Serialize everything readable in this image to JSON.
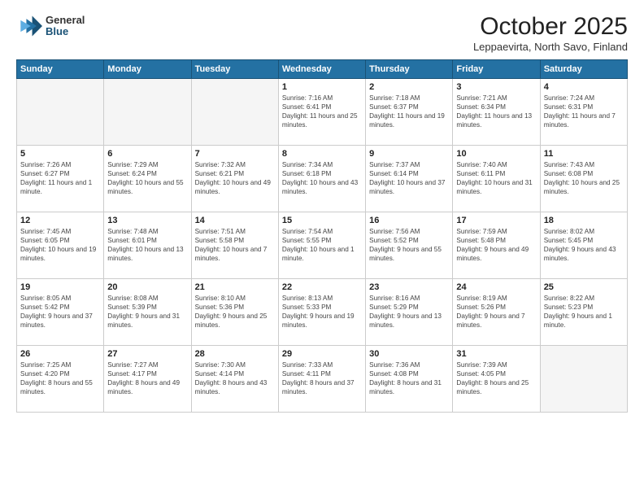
{
  "logo": {
    "general": "General",
    "blue": "Blue"
  },
  "title": "October 2025",
  "location": "Leppaevirta, North Savo, Finland",
  "days_header": [
    "Sunday",
    "Monday",
    "Tuesday",
    "Wednesday",
    "Thursday",
    "Friday",
    "Saturday"
  ],
  "weeks": [
    [
      {
        "num": "",
        "info": ""
      },
      {
        "num": "",
        "info": ""
      },
      {
        "num": "",
        "info": ""
      },
      {
        "num": "1",
        "info": "Sunrise: 7:16 AM\nSunset: 6:41 PM\nDaylight: 11 hours and 25 minutes."
      },
      {
        "num": "2",
        "info": "Sunrise: 7:18 AM\nSunset: 6:37 PM\nDaylight: 11 hours and 19 minutes."
      },
      {
        "num": "3",
        "info": "Sunrise: 7:21 AM\nSunset: 6:34 PM\nDaylight: 11 hours and 13 minutes."
      },
      {
        "num": "4",
        "info": "Sunrise: 7:24 AM\nSunset: 6:31 PM\nDaylight: 11 hours and 7 minutes."
      }
    ],
    [
      {
        "num": "5",
        "info": "Sunrise: 7:26 AM\nSunset: 6:27 PM\nDaylight: 11 hours and 1 minute."
      },
      {
        "num": "6",
        "info": "Sunrise: 7:29 AM\nSunset: 6:24 PM\nDaylight: 10 hours and 55 minutes."
      },
      {
        "num": "7",
        "info": "Sunrise: 7:32 AM\nSunset: 6:21 PM\nDaylight: 10 hours and 49 minutes."
      },
      {
        "num": "8",
        "info": "Sunrise: 7:34 AM\nSunset: 6:18 PM\nDaylight: 10 hours and 43 minutes."
      },
      {
        "num": "9",
        "info": "Sunrise: 7:37 AM\nSunset: 6:14 PM\nDaylight: 10 hours and 37 minutes."
      },
      {
        "num": "10",
        "info": "Sunrise: 7:40 AM\nSunset: 6:11 PM\nDaylight: 10 hours and 31 minutes."
      },
      {
        "num": "11",
        "info": "Sunrise: 7:43 AM\nSunset: 6:08 PM\nDaylight: 10 hours and 25 minutes."
      }
    ],
    [
      {
        "num": "12",
        "info": "Sunrise: 7:45 AM\nSunset: 6:05 PM\nDaylight: 10 hours and 19 minutes."
      },
      {
        "num": "13",
        "info": "Sunrise: 7:48 AM\nSunset: 6:01 PM\nDaylight: 10 hours and 13 minutes."
      },
      {
        "num": "14",
        "info": "Sunrise: 7:51 AM\nSunset: 5:58 PM\nDaylight: 10 hours and 7 minutes."
      },
      {
        "num": "15",
        "info": "Sunrise: 7:54 AM\nSunset: 5:55 PM\nDaylight: 10 hours and 1 minute."
      },
      {
        "num": "16",
        "info": "Sunrise: 7:56 AM\nSunset: 5:52 PM\nDaylight: 9 hours and 55 minutes."
      },
      {
        "num": "17",
        "info": "Sunrise: 7:59 AM\nSunset: 5:48 PM\nDaylight: 9 hours and 49 minutes."
      },
      {
        "num": "18",
        "info": "Sunrise: 8:02 AM\nSunset: 5:45 PM\nDaylight: 9 hours and 43 minutes."
      }
    ],
    [
      {
        "num": "19",
        "info": "Sunrise: 8:05 AM\nSunset: 5:42 PM\nDaylight: 9 hours and 37 minutes."
      },
      {
        "num": "20",
        "info": "Sunrise: 8:08 AM\nSunset: 5:39 PM\nDaylight: 9 hours and 31 minutes."
      },
      {
        "num": "21",
        "info": "Sunrise: 8:10 AM\nSunset: 5:36 PM\nDaylight: 9 hours and 25 minutes."
      },
      {
        "num": "22",
        "info": "Sunrise: 8:13 AM\nSunset: 5:33 PM\nDaylight: 9 hours and 19 minutes."
      },
      {
        "num": "23",
        "info": "Sunrise: 8:16 AM\nSunset: 5:29 PM\nDaylight: 9 hours and 13 minutes."
      },
      {
        "num": "24",
        "info": "Sunrise: 8:19 AM\nSunset: 5:26 PM\nDaylight: 9 hours and 7 minutes."
      },
      {
        "num": "25",
        "info": "Sunrise: 8:22 AM\nSunset: 5:23 PM\nDaylight: 9 hours and 1 minute."
      }
    ],
    [
      {
        "num": "26",
        "info": "Sunrise: 7:25 AM\nSunset: 4:20 PM\nDaylight: 8 hours and 55 minutes."
      },
      {
        "num": "27",
        "info": "Sunrise: 7:27 AM\nSunset: 4:17 PM\nDaylight: 8 hours and 49 minutes."
      },
      {
        "num": "28",
        "info": "Sunrise: 7:30 AM\nSunset: 4:14 PM\nDaylight: 8 hours and 43 minutes."
      },
      {
        "num": "29",
        "info": "Sunrise: 7:33 AM\nSunset: 4:11 PM\nDaylight: 8 hours and 37 minutes."
      },
      {
        "num": "30",
        "info": "Sunrise: 7:36 AM\nSunset: 4:08 PM\nDaylight: 8 hours and 31 minutes."
      },
      {
        "num": "31",
        "info": "Sunrise: 7:39 AM\nSunset: 4:05 PM\nDaylight: 8 hours and 25 minutes."
      },
      {
        "num": "",
        "info": ""
      }
    ]
  ]
}
